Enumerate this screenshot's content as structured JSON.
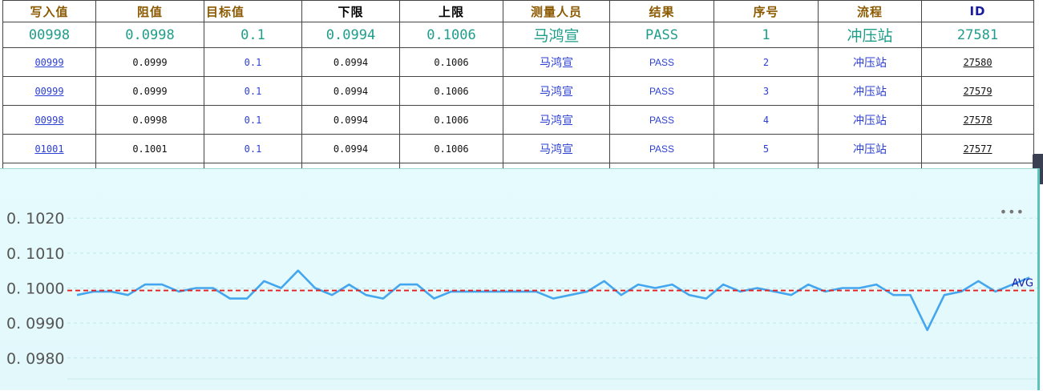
{
  "table": {
    "headers": [
      "写入值",
      "阻值",
      "目标值",
      "下限",
      "上限",
      "测量人员",
      "结果",
      "序号",
      "流程",
      "ID"
    ],
    "rows": [
      [
        "00998",
        "0.0998",
        "0.1",
        "0.0994",
        "0.1006",
        "马鸿宣",
        "PASS",
        "1",
        "冲压站",
        "27581"
      ],
      [
        "00999",
        "0.0999",
        "0.1",
        "0.0994",
        "0.1006",
        "马鸿宣",
        "PASS",
        "2",
        "冲压站",
        "27580"
      ],
      [
        "00999",
        "0.0999",
        "0.1",
        "0.0994",
        "0.1006",
        "马鸿宣",
        "PASS",
        "3",
        "冲压站",
        "27579"
      ],
      [
        "00998",
        "0.0998",
        "0.1",
        "0.0994",
        "0.1006",
        "马鸿宣",
        "PASS",
        "4",
        "冲压站",
        "27578"
      ],
      [
        "01001",
        "0.1001",
        "0.1",
        "0.0994",
        "0.1006",
        "马鸿宣",
        "PASS",
        "5",
        "冲压站",
        "27577"
      ]
    ]
  },
  "chart_data": {
    "type": "line",
    "y_tick_labels": [
      "0. 1020",
      "0. 1010",
      "0. 1000",
      "0. 0990",
      "0. 0980"
    ],
    "ylim": [
      0.0974,
      0.1026
    ],
    "ticks": [
      0.102,
      0.101,
      0.1,
      0.099,
      0.098
    ],
    "avg_label": "AVG",
    "avg_value": 0.09993,
    "series": [
      {
        "values": [
          0.0998,
          0.0999,
          0.0999,
          0.0998,
          0.1001,
          0.1001,
          0.0999,
          0.1,
          0.1,
          0.0997,
          0.0997,
          0.1002,
          0.1,
          0.1005,
          0.1,
          0.0998,
          0.1001,
          0.0998,
          0.0997,
          0.1001,
          0.1001,
          0.0997,
          0.0999,
          0.0999,
          0.0999,
          0.0999,
          0.0999,
          0.0999,
          0.0997,
          0.0998,
          0.0999,
          0.1002,
          0.0998,
          0.1001,
          0.1,
          0.1001,
          0.0998,
          0.0997,
          0.1001,
          0.0999,
          0.1,
          0.0999,
          0.0998,
          0.1001,
          0.0999,
          0.1,
          0.1,
          0.1001,
          0.0998,
          0.0998,
          0.0988,
          0.0998,
          0.0999,
          0.1002,
          0.0999,
          0.1001,
          0.1003
        ]
      }
    ],
    "grid": "horizontal dashed",
    "colors": {
      "line": "#44a6ee",
      "avg": "#e02020",
      "avg_label": "#1a1aa8",
      "axis_text": "#555555"
    }
  },
  "toolbar": {
    "more_icon": "•••"
  }
}
